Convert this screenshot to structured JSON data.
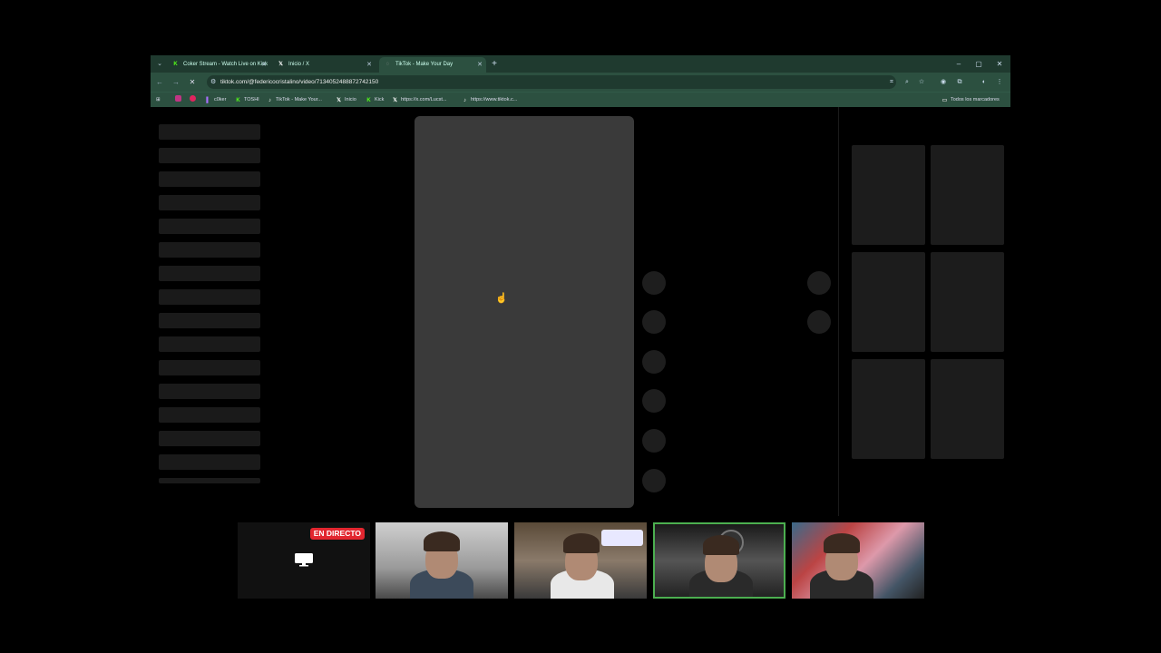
{
  "browser": {
    "tabs": [
      {
        "label": "Coker Stream - Watch Live on Kick",
        "favicon": "kick-icon",
        "active": false
      },
      {
        "label": "Inicio / X",
        "favicon": "x-icon",
        "active": false
      },
      {
        "label": "TikTok - Make Your Day",
        "favicon": "tiktok-icon",
        "active": true
      }
    ],
    "new_tab": "+",
    "window_controls": {
      "minimize": "–",
      "maximize": "▢",
      "close": "✕"
    },
    "url": "tiktok.com/@federicocristalino/video/7134052488872742150",
    "bookmarks": [
      {
        "label": "",
        "icon": "instagram-icon"
      },
      {
        "label": "",
        "icon": "youtube-icon"
      },
      {
        "label": "c0ker",
        "icon": "twitch-icon"
      },
      {
        "label": "TOSHI",
        "icon": "kick-icon"
      },
      {
        "label": "TikTok - Make Your...",
        "icon": "tiktok-icon"
      },
      {
        "label": "Inicio",
        "icon": "x-icon"
      },
      {
        "label": "Kick",
        "icon": "kick-icon"
      },
      {
        "label": "https://x.com/Lucst...",
        "icon": "x-icon"
      },
      {
        "label": "https://www.tiktok.c...",
        "icon": "tiktok-icon"
      }
    ],
    "all_bookmarks": "Todos los marcadores"
  },
  "stream": {
    "live_badge": "EN DIRECTO"
  },
  "colors": {
    "chrome_tab_bar": "#1f3a2f",
    "chrome_toolbar": "#2c5040",
    "video_placeholder": "#3a3a3a",
    "live_red": "#e2262f",
    "selected_cam": "#4caf50"
  }
}
